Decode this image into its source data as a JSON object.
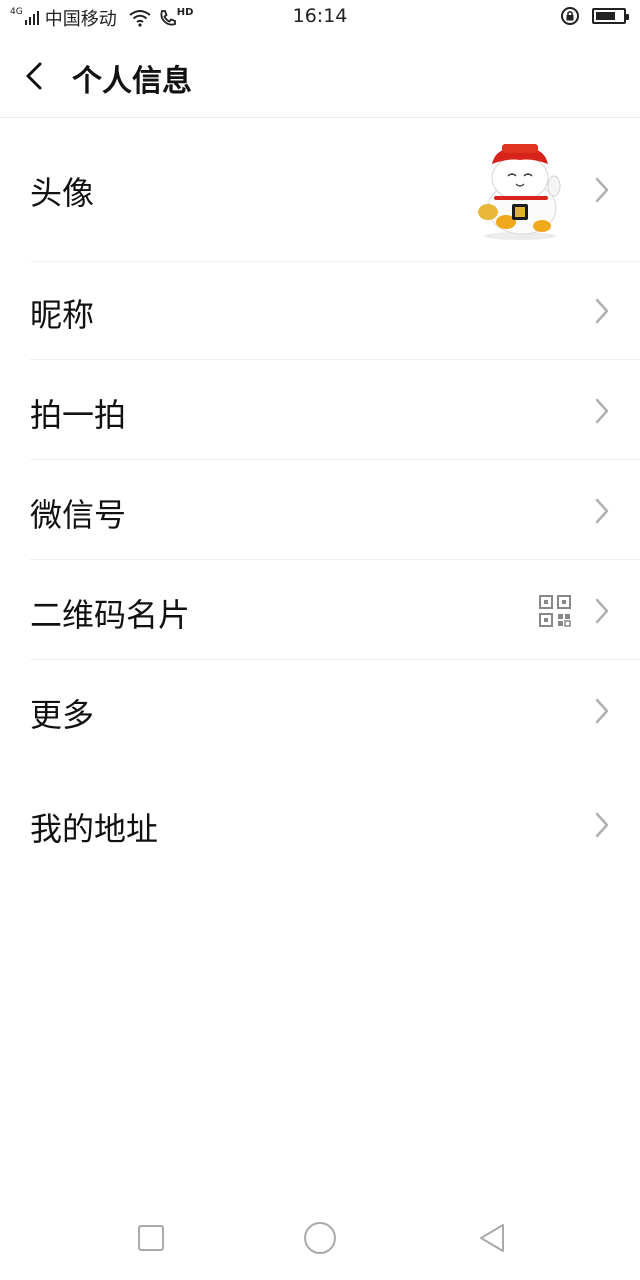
{
  "status_bar": {
    "network": "4G",
    "carrier": "中国移动",
    "hd_badge": "HD",
    "time": "16:14"
  },
  "header": {
    "title": "个人信息"
  },
  "rows": [
    {
      "label": "头像"
    },
    {
      "label": "昵称"
    },
    {
      "label": "拍一拍"
    },
    {
      "label": "微信号"
    },
    {
      "label": "二维码名片"
    },
    {
      "label": "更多"
    },
    {
      "label": "我的地址"
    }
  ],
  "icons": {
    "back": "chevron-left-icon",
    "row_arrow": "chevron-right-icon",
    "qr": "qr-code-icon",
    "wifi": "wifi-icon",
    "call": "phone-icon",
    "lock": "rotation-lock-icon",
    "battery": "battery-icon"
  },
  "colors": {
    "text": "#111111",
    "chevron": "#b0b0b0",
    "divider": "#f0f0f0",
    "background": "#ffffff"
  }
}
